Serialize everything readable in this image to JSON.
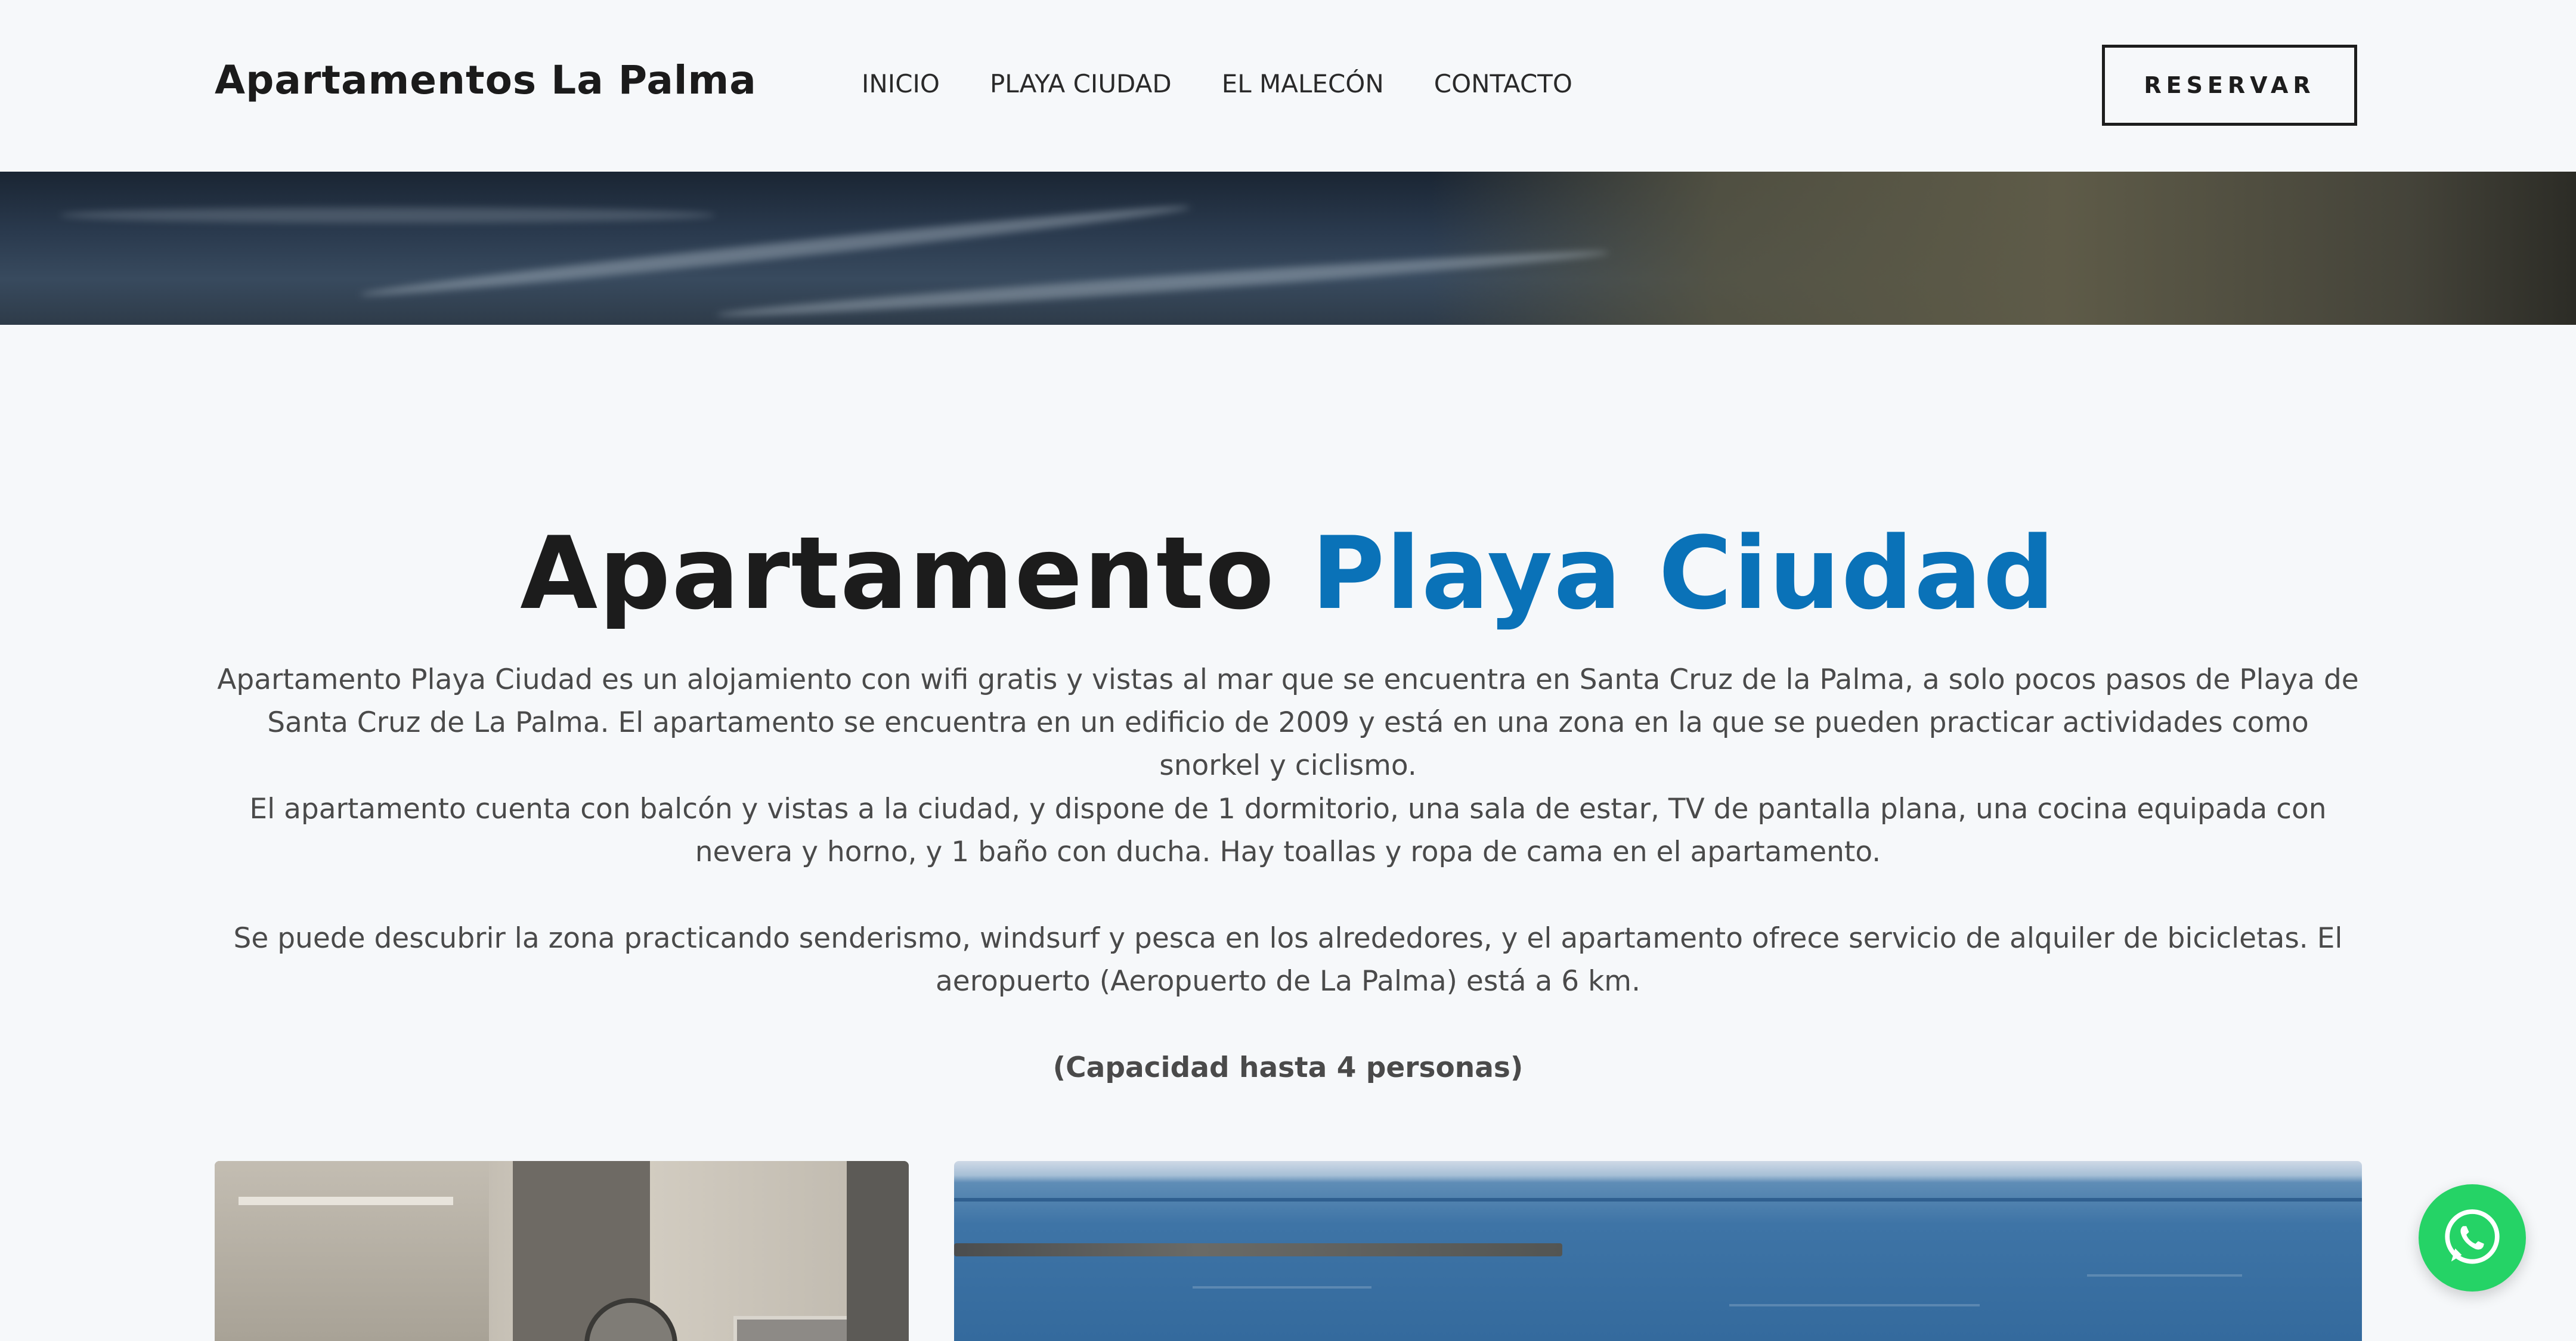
{
  "header": {
    "brand": "Apartamentos La Palma",
    "nav": [
      {
        "label": "INICIO"
      },
      {
        "label": "PLAYA CIUDAD"
      },
      {
        "label": "EL MALECÓN"
      },
      {
        "label": "CONTACTO"
      }
    ],
    "reserve_label": "RESERVAR"
  },
  "main": {
    "title_dark": "Apartamento",
    "title_accent": "Playa Ciudad",
    "paragraphs": [
      "Apartamento Playa Ciudad es un alojamiento con wifi gratis y vistas al mar que se encuentra en Santa Cruz de la Palma, a solo pocos pasos de Playa de Santa Cruz de La Palma. El apartamento se encuentra en un edificio de 2009 y está en una zona en la que se pueden practicar actividades como snorkel y ciclismo.",
      "El apartamento cuenta con balcón y vistas a la ciudad, y dispone de 1 dormitorio, una sala de estar, TV de pantalla plana, una cocina equipada con nevera y horno, y 1 baño con ducha. Hay toallas y ropa de cama en el apartamento.",
      "Se puede descubrir la zona practicando senderismo, windsurf y pesca en los alrededores, y el apartamento ofrece servicio de alquiler de bicicletas. El aeropuerto (Aeropuerto de La Palma) está a 6 km."
    ],
    "capacity": "(Capacidad hasta 4 personas)"
  },
  "icons": {
    "whatsapp": "whatsapp-icon"
  },
  "colors": {
    "accent": "#0a72b8",
    "background": "#f6f8fa",
    "whatsapp": "#25d366"
  }
}
